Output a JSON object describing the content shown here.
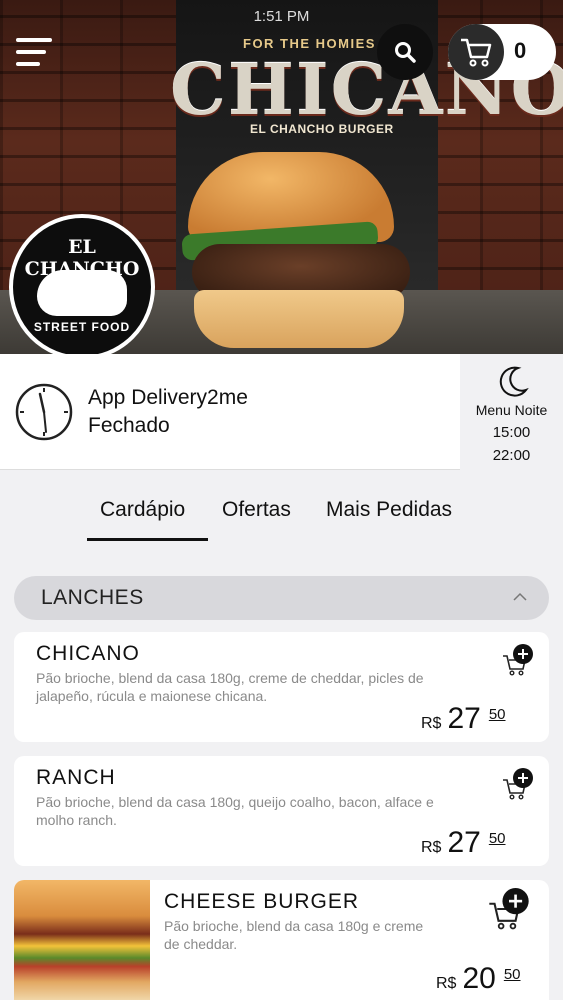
{
  "status_bar": {
    "time": "1:51 PM"
  },
  "hero": {
    "banner_sub": "FOR THE HOMIES",
    "banner_title": "CHICANO",
    "banner_tagline": "EL CHANCHO BURGER",
    "logo_top": "EL CHANCHO",
    "logo_bottom": "STREET FOOD"
  },
  "header": {
    "cart_count": "0",
    "icons": [
      "menu-icon",
      "search-icon",
      "cart-icon"
    ]
  },
  "store": {
    "name": "App Delivery2me",
    "status": "Fechado"
  },
  "schedule": {
    "label": "Menu Noite",
    "start": "15:00",
    "end": "22:00"
  },
  "tabs": [
    {
      "label": "Cardápio",
      "active": true
    },
    {
      "label": "Ofertas",
      "active": false
    },
    {
      "label": "Mais Pedidas",
      "active": false
    }
  ],
  "category": {
    "title": "LANCHES"
  },
  "products": [
    {
      "name": "CHICANO",
      "description": "Pão brioche, blend da casa 180g, creme de cheddar, picles de jalapeño, rúcula e maionese chicana.",
      "currency": "R$",
      "price_int": "27",
      "price_cents": "50"
    },
    {
      "name": "RANCH",
      "description": "Pão brioche, blend da casa 180g, queijo coalho, bacon, alface e molho ranch.",
      "currency": "R$",
      "price_int": "27",
      "price_cents": "50"
    },
    {
      "name": "CHEESE BURGER",
      "description": "Pão brioche, blend da casa 180g e creme de cheddar.",
      "currency": "R$",
      "price_int": "20",
      "price_cents": "50"
    }
  ],
  "colors": {
    "accent": "#111111",
    "background": "#f1f1f3",
    "category_bg": "#d8d8dc",
    "muted_text": "#8a8a8a"
  }
}
